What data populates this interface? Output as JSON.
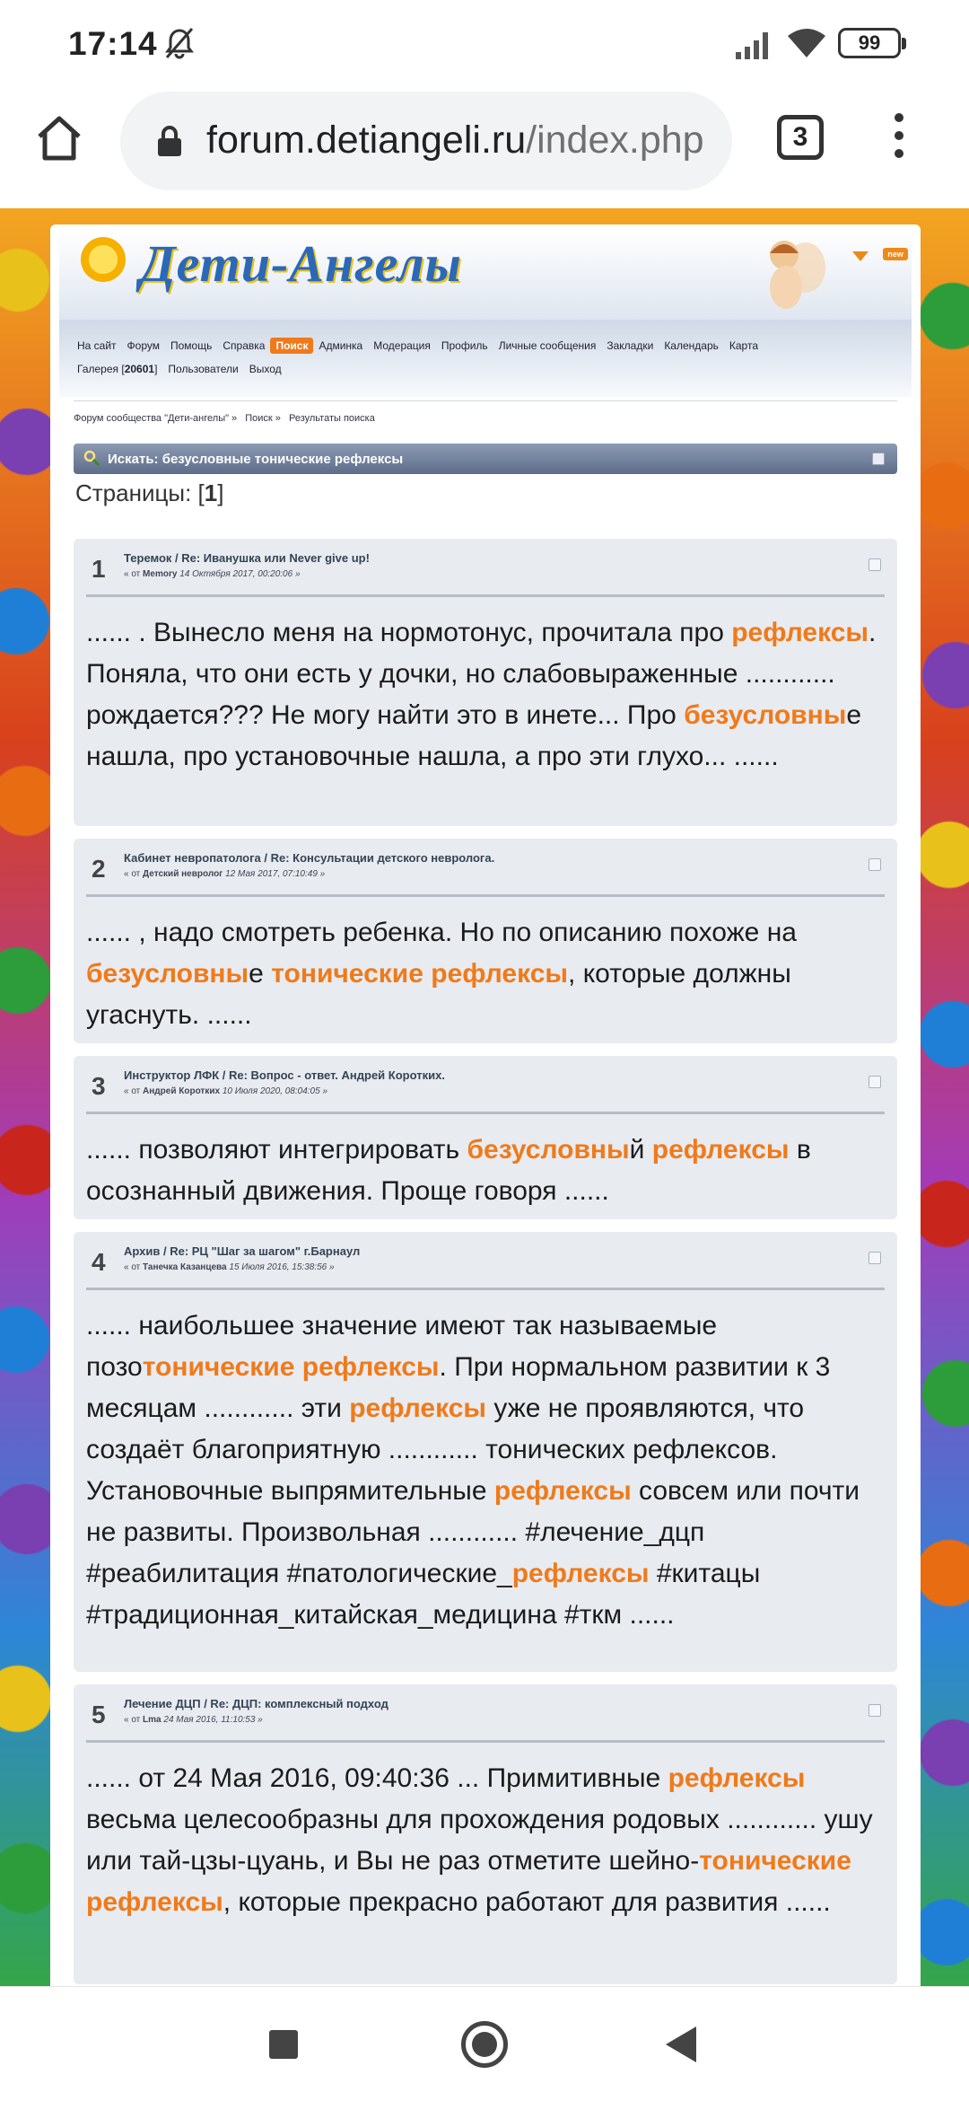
{
  "status_bar": {
    "time": "17:14",
    "battery": "99"
  },
  "browser": {
    "url_domain": "forum.detiangeli.ru",
    "url_path": "/index.php",
    "tab_count": "3"
  },
  "forum": {
    "logo": "Дети-Ангелы",
    "new_badge": "new",
    "nav_row1": [
      "На сайт",
      "Форум",
      "Помощь",
      "Справка",
      "Поиск",
      "Админка",
      "Модерация",
      "Профиль",
      "Личные сообщения",
      "Закладки",
      "Календарь",
      "Карта"
    ],
    "nav_gallery": "Галерея",
    "nav_gallery_count": "20601",
    "nav_users": "Пользователи",
    "nav_logout": "Выход",
    "breadcrumbs": [
      "Форум сообщества \"Дети-ангелы\" »",
      "Поиск »",
      "Результаты поиска"
    ],
    "search_title": "Искать: безусловные тонические рефлексы",
    "pages_label": "Страницы: [",
    "pages_current": "1",
    "pages_close": "]"
  },
  "results": [
    {
      "num": "1",
      "topic": "Теремок / Re: Иванушка или Never give up!",
      "by": "« от",
      "author": "Memory",
      "date": "14 Октября 2017, 00:20:06 »",
      "body": [
        {
          "t": "...... . Вынесло меня на нормотонус, прочитала про "
        },
        {
          "t": "рефлексы",
          "h": true
        },
        {
          "t": ". Поняла, что они есть у дочки, но слабовыраженные  ............  рождается??? Не могу найти это в инете... Про "
        },
        {
          "t": "безусловны",
          "h": true
        },
        {
          "t": "е нашла, про установочные нашла, а про эти глухо... ......"
        }
      ]
    },
    {
      "num": "2",
      "topic": "Кабинет невропатолога / Re: Консультации детского невролога.",
      "by": "« от",
      "author": "Детский невролог",
      "date": "12 Мая 2017, 07:10:49 »",
      "body": [
        {
          "t": "...... , надо смотреть ребенка. Но по описанию похоже на "
        },
        {
          "t": "безусловны",
          "h": true
        },
        {
          "t": "е "
        },
        {
          "t": "тонические рефлексы",
          "h": true
        },
        {
          "t": ", которые должны угаснуть.  ......"
        }
      ]
    },
    {
      "num": "3",
      "topic": "Инструктор ЛФК / Re: Вопрос - ответ. Андрей Коротких.",
      "by": "« от",
      "author": "Андрей Коротких",
      "date": "10 Июля 2020, 08:04:05 »",
      "body": [
        {
          "t": "......  позволяют интегрировать "
        },
        {
          "t": "безусловны",
          "h": true
        },
        {
          "t": "й "
        },
        {
          "t": "рефлексы",
          "h": true
        },
        {
          "t": " в осознанный движения. Проще говоря  ......"
        }
      ]
    },
    {
      "num": "4",
      "topic": "Архив / Re: РЦ \"Шаг за шагом\" г.Барнаул",
      "by": "« от",
      "author": "Танечка Казанцева",
      "date": "15 Июля 2016, 15:38:56 »",
      "body": [
        {
          "t": "......  наибольшее значение имеют так называемые позо"
        },
        {
          "t": "тонические рефлексы",
          "h": true
        },
        {
          "t": ". При нормальном развитии к 3 месяцам  ............  эти "
        },
        {
          "t": "рефлексы",
          "h": true
        },
        {
          "t": " уже не проявляются, что создаёт благоприятную  ............  тонических рефлексов. Установочные выпрямительные "
        },
        {
          "t": "рефлексы",
          "h": true
        },
        {
          "t": " совсем или почти не развиты. Произвольная  ............ #лечение_дцп #реабилитация #патологические_"
        },
        {
          "t": "рефлексы",
          "h": true
        },
        {
          "t": " #китацы #традиционная_китайская_медицина #ткм  ......"
        }
      ]
    },
    {
      "num": "5",
      "topic": "Лечение ДЦП / Re: ДЦП: комплексный подход",
      "by": "« от",
      "author": "Lma",
      "date": "24 Мая 2016, 11:10:53 »",
      "body": [
        {
          "t": "......  от 24 Мая 2016, 09:40:36  ... Примитивные "
        },
        {
          "t": "рефлексы",
          "h": true
        },
        {
          "t": " весьма целесообразны для прохождения родовых  ............  ушу или тай-цзы-цуань, и Вы не раз отметите шейно-"
        },
        {
          "t": "тонические рефлексы",
          "h": true
        },
        {
          "t": ", которые прекрасно работают для развития  ......"
        }
      ]
    }
  ]
}
